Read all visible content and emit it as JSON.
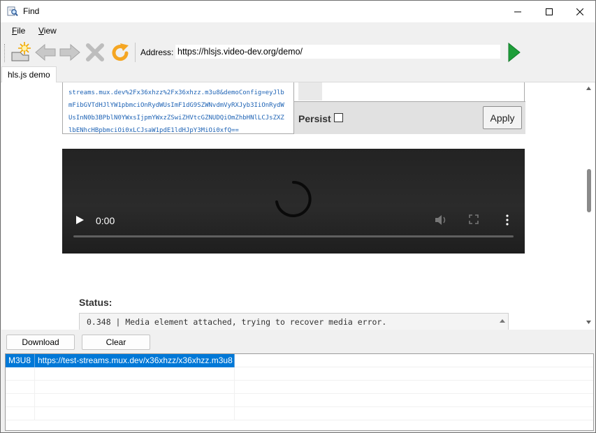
{
  "window": {
    "title": "Find"
  },
  "menu": {
    "file": "File",
    "file_access": "F",
    "file_rest": "ile",
    "view": "View",
    "view_access": "V",
    "view_rest": "iew"
  },
  "toolbar": {
    "address_label": "Address:",
    "address_value": "https://hlsjs.video-dev.org/demo/",
    "icons": [
      "new-session-icon",
      "back-arrow-icon",
      "forward-arrow-icon",
      "stop-icon",
      "refresh-icon",
      "go-arrow-icon"
    ]
  },
  "tabs": [
    {
      "label": "hls.js demo",
      "active": true
    }
  ],
  "page": {
    "config_lines": [
      "streams.mux.dev%2Fx36xhzz%2Fx36xhzz.m3u8&demoConfig=eyJlb",
      "mFibGVTdHJlYW1pbmciOnRydWUsImF1dG9SZWNvdmVyRXJyb3IiOnRydW",
      "UsInN0b3BPblN0YWxsIjpmYWxzZSwiZHVtcGZNUDQiOmZhbHNlLCJsZXZ",
      "lbENhcHBpbmciOi0xLCJsaW1pdE1ldHJpY3MiOi0xfQ=="
    ],
    "persist_label": "Persist",
    "persist_checked": false,
    "apply_label": "Apply",
    "video": {
      "time": "0:00",
      "progress_fraction": 0.0
    },
    "status_label": "Status:",
    "status_text": "0.348 | Media element attached, trying to recover media error."
  },
  "buttons": {
    "download": "Download",
    "clear": "Clear"
  },
  "results": {
    "rows": [
      {
        "type": "M3U8",
        "url": "https://test-streams.mux.dev/x36xhzz/x36xhzz.m3u8",
        "selected": true
      },
      {
        "type": "",
        "url": "",
        "selected": false
      },
      {
        "type": "",
        "url": "",
        "selected": false
      },
      {
        "type": "",
        "url": "",
        "selected": false
      },
      {
        "type": "",
        "url": "",
        "selected": false
      }
    ]
  },
  "colors": {
    "selection": "#0078d7",
    "link_text": "#1e63b5",
    "go_green": "#1e9e3a",
    "refresh_orange": "#f5a623"
  }
}
